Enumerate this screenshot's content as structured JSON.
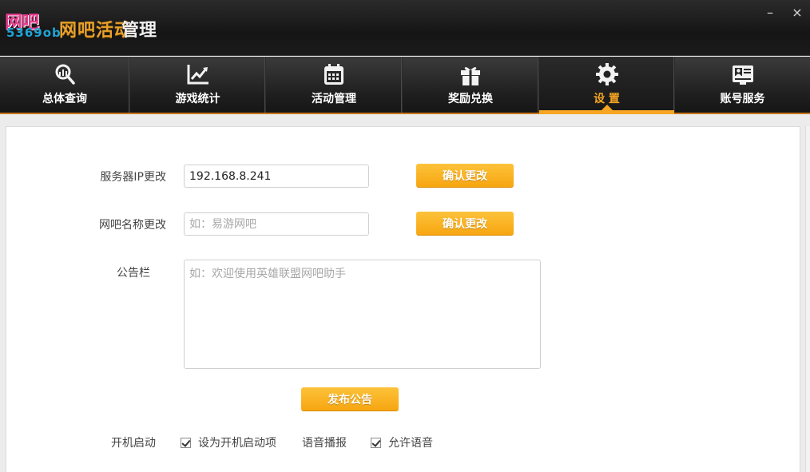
{
  "app": {
    "logo_brand": "网吧",
    "logo_sub": "5369ob",
    "logo_title": "网吧活动",
    "logo_title_suffix": "管理"
  },
  "window_controls": {
    "minimize": "–",
    "close": "×"
  },
  "nav": {
    "items": [
      {
        "label": "总体查询",
        "icon": "search-chart-icon",
        "active": false
      },
      {
        "label": "游戏统计",
        "icon": "line-chart-icon",
        "active": false
      },
      {
        "label": "活动管理",
        "icon": "calendar-icon",
        "active": false
      },
      {
        "label": "奖励兑换",
        "icon": "gift-icon",
        "active": false
      },
      {
        "label": "设 置",
        "icon": "gear-icon",
        "active": true
      },
      {
        "label": "账号服务",
        "icon": "id-card-icon",
        "active": false
      }
    ]
  },
  "settings": {
    "server_ip_label": "服务器IP更改",
    "server_ip_value": "192.168.8.241",
    "server_ip_confirm": "确认更改",
    "cafe_name_label": "网吧名称更改",
    "cafe_name_placeholder": "如：易游网吧",
    "cafe_name_confirm": "确认更改",
    "notice_label": "公告栏",
    "notice_placeholder": "如：欢迎使用英雄联盟网吧助手",
    "publish_button": "发布公告",
    "startup_label": "开机启动",
    "startup_option": "设为开机启动项",
    "startup_checked": true,
    "voice_label": "语音播报",
    "voice_option": "允许语音",
    "voice_checked": true
  },
  "colors": {
    "accent": "#f6a623",
    "titlebar": "#1b1b1b",
    "navbar": "#262626"
  }
}
